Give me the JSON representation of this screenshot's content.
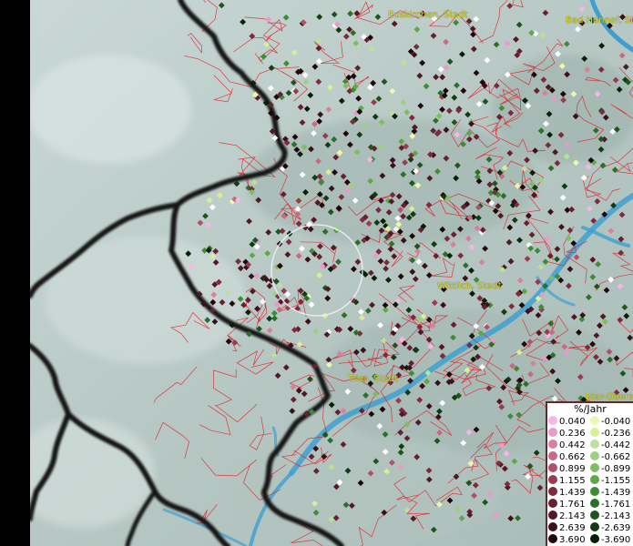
{
  "map": {
    "places": [
      {
        "label": "Euskirchen, Stadt"
      },
      {
        "label": "Bad Honnef, St"
      },
      {
        "label": "Wittlich, Stadt"
      },
      {
        "label": "Trier, Stadt"
      },
      {
        "label": "Idar-Oberst"
      }
    ]
  },
  "legend": {
    "title": "%/Jahr",
    "positive": [
      "0.040",
      "0.236",
      "0.442",
      "0.662",
      "0.899",
      "1.155",
      "1.439",
      "1.761",
      "2.143",
      "2.639",
      "3.690"
    ],
    "negative": [
      "-0.040",
      "-0.236",
      "-0.442",
      "-0.662",
      "-0.899",
      "-1.155",
      "-1.439",
      "-1.761",
      "-2.143",
      "-2.639",
      "-3.690"
    ],
    "positive_colors": [
      "#f7b6e6",
      "#e89bc8",
      "#d9809f",
      "#c86a85",
      "#b0506a",
      "#983a52",
      "#7e2a3e",
      "#68202f",
      "#521824",
      "#3c101a",
      "#200608"
    ],
    "negative_colors": [
      "#eef7b0",
      "#d8ef98",
      "#bde09a",
      "#9fcf80",
      "#7fbd63",
      "#5ea84a",
      "#3e8c35",
      "#2a7028",
      "#1c561c",
      "#103c12",
      "#062006"
    ]
  },
  "colors": {
    "boundary": "#e0202a",
    "border": "#151515",
    "river": "#3fa0d0"
  }
}
